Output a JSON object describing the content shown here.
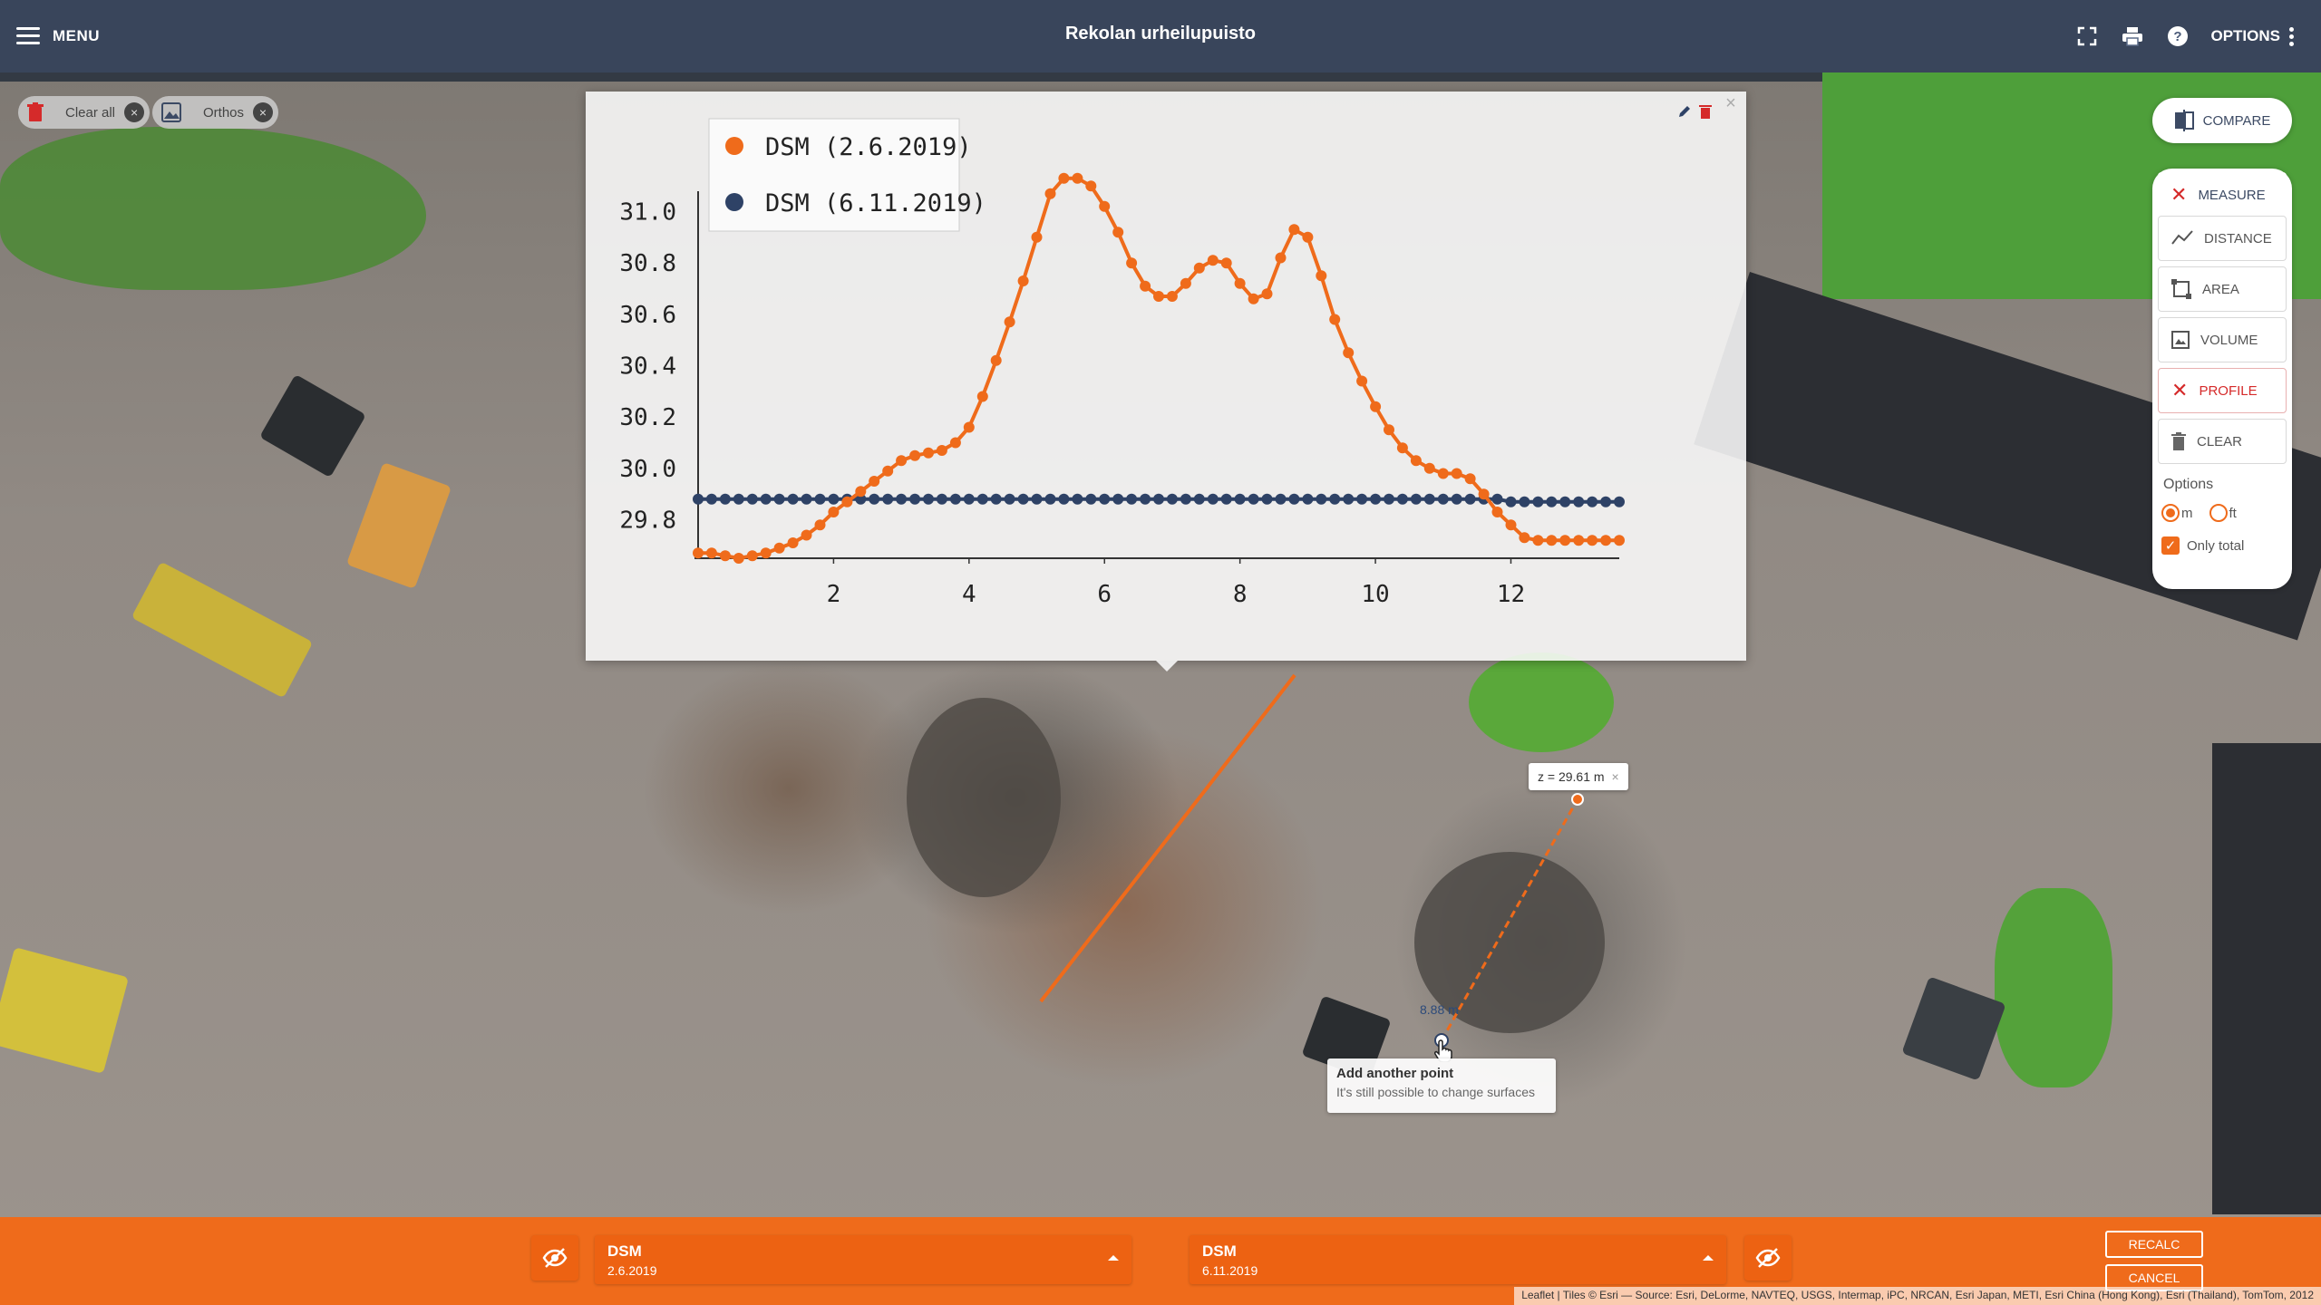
{
  "topbar": {
    "menu_label": "MENU",
    "title": "Rekolan urheilupuisto",
    "options_label": "OPTIONS"
  },
  "chips": {
    "clear_all": "Clear all",
    "orthos": "Orthos"
  },
  "tools": {
    "compare": "COMPARE",
    "measure": "MEASURE",
    "distance": "DISTANCE",
    "area": "AREA",
    "volume": "VOLUME",
    "profile": "PROFILE",
    "clear": "CLEAR",
    "options_label": "Options",
    "unit_m": "m",
    "unit_ft": "ft",
    "only_total": "Only total",
    "unit_selected": "m",
    "only_total_checked": true
  },
  "map": {
    "z_label": "z = 29.61 m",
    "distance_label": "8.88 m",
    "tooltip_title": "Add another point",
    "tooltip_text": "It's still possible to change surfaces",
    "attribution": "Leaflet | Tiles © Esri — Source: Esri, DeLorme, NAVTEQ, USGS, Intermap, iPC, NRCAN, Esri Japan, METI, Esri China (Hong Kong), Esri (Thailand), TomTom, 2012"
  },
  "bottombar": {
    "left_surface_name": "DSM",
    "left_surface_date": "2.6.2019",
    "right_surface_name": "DSM",
    "right_surface_date": "6.11.2019",
    "recalc": "RECALC",
    "cancel": "CANCEL"
  },
  "colors": {
    "accent": "#ef6b1b",
    "navy": "#2e4266",
    "orange_series": "#ef6b1b",
    "blue_series": "#2e4266"
  },
  "chart_data": {
    "type": "line",
    "xlim": [
      0,
      13.6
    ],
    "ylim": [
      29.65,
      31.15
    ],
    "x_ticks": [
      2,
      4,
      6,
      8,
      10,
      12
    ],
    "y_ticks": [
      29.8,
      30.0,
      30.2,
      30.4,
      30.6,
      30.8,
      31.0
    ],
    "x_tick_labels": [
      "2",
      "4",
      "6",
      "8",
      "10",
      "12"
    ],
    "y_tick_labels": [
      "29.8",
      "30.0",
      "30.2",
      "30.4",
      "30.6",
      "30.8",
      "31.0"
    ],
    "legend_position": "top-left",
    "grid": false,
    "series": [
      {
        "name": "DSM (2.6.2019)",
        "color": "#ef6b1b",
        "x": [
          0.0,
          0.2,
          0.4,
          0.6,
          0.8,
          1.0,
          1.2,
          1.4,
          1.6,
          1.8,
          2.0,
          2.2,
          2.4,
          2.6,
          2.8,
          3.0,
          3.2,
          3.4,
          3.6,
          3.8,
          4.0,
          4.2,
          4.4,
          4.6,
          4.8,
          5.0,
          5.2,
          5.4,
          5.6,
          5.8,
          6.0,
          6.2,
          6.4,
          6.6,
          6.8,
          7.0,
          7.2,
          7.4,
          7.6,
          7.8,
          8.0,
          8.2,
          8.4,
          8.6,
          8.8,
          9.0,
          9.2,
          9.4,
          9.6,
          9.8,
          10.0,
          10.2,
          10.4,
          10.6,
          10.8,
          11.0,
          11.2,
          11.4,
          11.6,
          11.8,
          12.0,
          12.2,
          12.4,
          12.6,
          12.8,
          13.0,
          13.2,
          13.4,
          13.6
        ],
        "y": [
          29.67,
          29.67,
          29.66,
          29.65,
          29.66,
          29.67,
          29.69,
          29.71,
          29.74,
          29.78,
          29.83,
          29.87,
          29.91,
          29.95,
          29.99,
          30.03,
          30.05,
          30.06,
          30.07,
          30.1,
          30.16,
          30.28,
          30.42,
          30.57,
          30.73,
          30.9,
          31.07,
          31.13,
          31.13,
          31.1,
          31.02,
          30.92,
          30.8,
          30.71,
          30.67,
          30.67,
          30.72,
          30.78,
          30.81,
          30.8,
          30.72,
          30.66,
          30.68,
          30.82,
          30.93,
          30.9,
          30.75,
          30.58,
          30.45,
          30.34,
          30.24,
          30.15,
          30.08,
          30.03,
          30.0,
          29.98,
          29.98,
          29.96,
          29.9,
          29.83,
          29.78,
          29.73,
          29.72,
          29.72,
          29.72,
          29.72,
          29.72,
          29.72,
          29.72
        ]
      },
      {
        "name": "DSM (6.11.2019)",
        "color": "#2e4266",
        "x": [
          0.0,
          0.2,
          0.4,
          0.6,
          0.8,
          1.0,
          1.2,
          1.4,
          1.6,
          1.8,
          2.0,
          2.2,
          2.4,
          2.6,
          2.8,
          3.0,
          3.2,
          3.4,
          3.6,
          3.8,
          4.0,
          4.2,
          4.4,
          4.6,
          4.8,
          5.0,
          5.2,
          5.4,
          5.6,
          5.8,
          6.0,
          6.2,
          6.4,
          6.6,
          6.8,
          7.0,
          7.2,
          7.4,
          7.6,
          7.8,
          8.0,
          8.2,
          8.4,
          8.6,
          8.8,
          9.0,
          9.2,
          9.4,
          9.6,
          9.8,
          10.0,
          10.2,
          10.4,
          10.6,
          10.8,
          11.0,
          11.2,
          11.4,
          11.6,
          11.8,
          12.0,
          12.2,
          12.4,
          12.6,
          12.8,
          13.0,
          13.2,
          13.4,
          13.6
        ],
        "y": [
          29.88,
          29.88,
          29.88,
          29.88,
          29.88,
          29.88,
          29.88,
          29.88,
          29.88,
          29.88,
          29.88,
          29.88,
          29.88,
          29.88,
          29.88,
          29.88,
          29.88,
          29.88,
          29.88,
          29.88,
          29.88,
          29.88,
          29.88,
          29.88,
          29.88,
          29.88,
          29.88,
          29.88,
          29.88,
          29.88,
          29.88,
          29.88,
          29.88,
          29.88,
          29.88,
          29.88,
          29.88,
          29.88,
          29.88,
          29.88,
          29.88,
          29.88,
          29.88,
          29.88,
          29.88,
          29.88,
          29.88,
          29.88,
          29.88,
          29.88,
          29.88,
          29.88,
          29.88,
          29.88,
          29.88,
          29.88,
          29.88,
          29.88,
          29.88,
          29.88,
          29.87,
          29.87,
          29.87,
          29.87,
          29.87,
          29.87,
          29.87,
          29.87,
          29.87
        ]
      }
    ]
  }
}
